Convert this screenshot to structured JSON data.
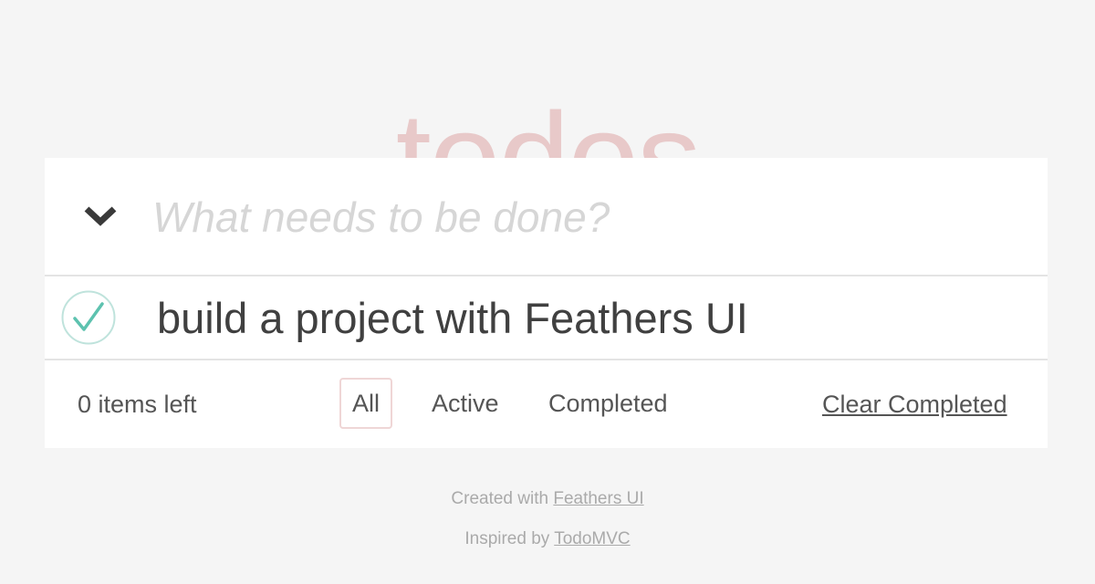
{
  "header": {
    "title": "todos"
  },
  "new_todo": {
    "placeholder": "What needs to be done?",
    "toggle_all_icon": "chevron-down-icon"
  },
  "todos": [
    {
      "label": "build a project with Feathers UI",
      "completed": true,
      "check_icon": "checkmark-circle-icon"
    }
  ],
  "footer": {
    "items_left": "0 items left",
    "filters": [
      {
        "label": "All",
        "selected": true
      },
      {
        "label": "Active",
        "selected": false
      },
      {
        "label": "Completed",
        "selected": false
      }
    ],
    "clear_completed": "Clear Completed"
  },
  "info": {
    "created_prefix": "Created with ",
    "created_link": "Feathers UI",
    "inspired_prefix": "Inspired by ",
    "inspired_link": "TodoMVC"
  },
  "colors": {
    "background": "#f5f5f5",
    "title": "#e8c9c9",
    "check": "#5dc2af",
    "check_ring": "#bfe3dc",
    "selected_filter_border": "#efd6d6"
  }
}
